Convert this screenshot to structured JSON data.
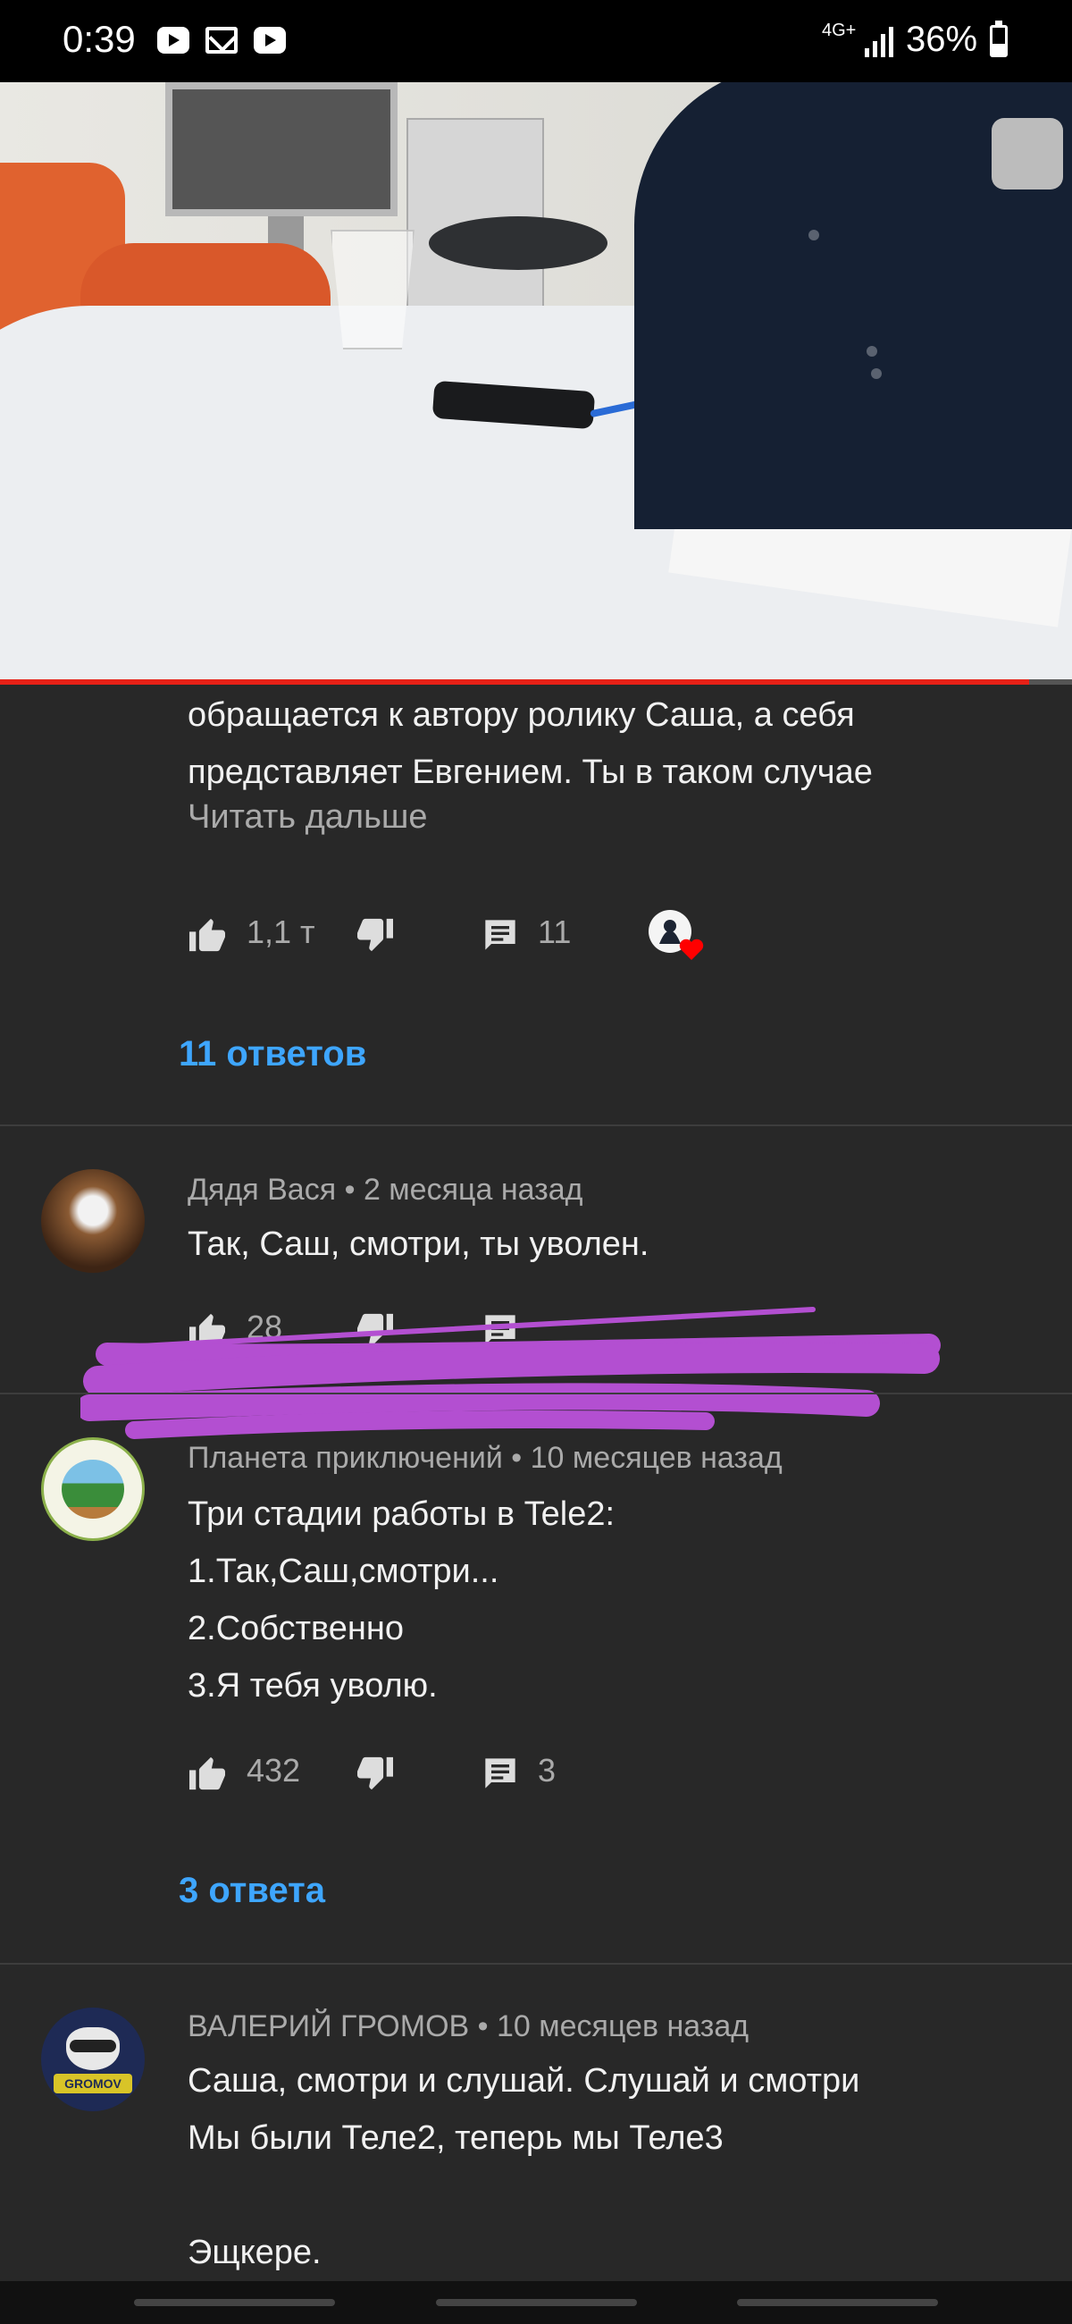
{
  "status_bar": {
    "time": "0:39",
    "network": "4G+",
    "battery": "36%",
    "notification_icons": [
      "youtube-icon",
      "mail-icon",
      "youtube-icon"
    ]
  },
  "video": {
    "progress_fraction": 0.96,
    "accent_color": "#e62117"
  },
  "comments": [
    {
      "text": "обращается к автору ролику Саша, а себя\nпредставляет Евгением. Ты в таком случае",
      "read_more": "Читать дальше",
      "likes": "1,1 т",
      "reply_count": "11",
      "replies_link": "11 ответов"
    },
    {
      "author": "Дядя Вася",
      "time": "2 месяца назад",
      "text": "Так, Саш, смотри, ты уволен.",
      "likes": "28"
    },
    {
      "author": "Планета приключений",
      "time": "10 месяцев назад",
      "text": "Три стадии работы в Tele2:\n1.Так,Саш,смотри...\n2.Собственно\n3.Я тебя уволю.",
      "likes": "432",
      "reply_count": "3",
      "replies_link": "3 ответа"
    },
    {
      "author": "ВАЛЕРИЙ ГРОМОВ",
      "time": "10 месяцев назад",
      "text": "Саша, смотри и слушай. Слушай и смотри\nМы были Теле2, теперь мы Теле3\n\nЭщкере.",
      "avatar_text": "GROMOV"
    }
  ],
  "colors": {
    "background": "#282828",
    "link": "#3ea6ff",
    "scribble": "#b34fd1",
    "heart": "#ff0000"
  }
}
